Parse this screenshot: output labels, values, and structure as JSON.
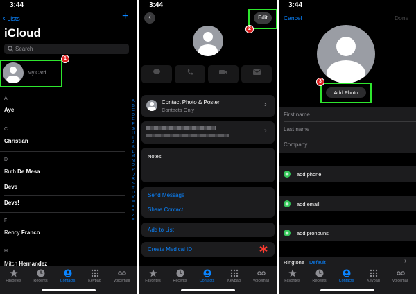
{
  "panel1": {
    "time": "3:44",
    "back_label": "Lists",
    "add_symbol": "+",
    "title": "iCloud",
    "search_placeholder": "Search",
    "my_card_label": "My Card",
    "step_badge": "1",
    "sections": [
      {
        "letter": "A",
        "names": [
          "Aye"
        ]
      },
      {
        "letter": "C",
        "names": [
          "Christian"
        ]
      },
      {
        "letter": "D",
        "names": [
          "Ruth De Mesa",
          "Devs",
          "Devs!"
        ]
      },
      {
        "letter": "F",
        "names": [
          "Rency Franco"
        ]
      },
      {
        "letter": "H",
        "names": [
          "Mitch Hernandez"
        ]
      }
    ],
    "index_letters": [
      "A",
      "B",
      "C",
      "D",
      "E",
      "F",
      "G",
      "H",
      "I",
      "J",
      "K",
      "L",
      "M",
      "N",
      "O",
      "P",
      "Q",
      "R",
      "S",
      "T",
      "U",
      "V",
      "W",
      "X",
      "Y",
      "Z",
      "#"
    ]
  },
  "panel2": {
    "time": "3:44",
    "edit_label": "Edit",
    "step_badge": "2",
    "action_buttons": [
      "message",
      "call",
      "video",
      "mail"
    ],
    "contact_photo_title": "Contact Photo & Poster",
    "contact_photo_sub": "Contacts Only",
    "notes_label": "Notes",
    "send_message": "Send Message",
    "share_contact": "Share Contact",
    "add_to_list": "Add to List",
    "create_medical_id": "Create Medical ID"
  },
  "panel3": {
    "time": "3:44",
    "cancel_label": "Cancel",
    "done_label": "Done",
    "add_photo_label": "Add Photo",
    "step_badge": "3",
    "first_name_placeholder": "First name",
    "last_name_placeholder": "Last name",
    "company_placeholder": "Company",
    "add_phone": "add phone",
    "add_email": "add email",
    "add_pronouns": "add pronouns",
    "ringtone_label": "Ringtone",
    "ringtone_value": "Default"
  },
  "tabbar": {
    "tabs": [
      "Favorites",
      "Recents",
      "Contacts",
      "Keypad",
      "Voicemail"
    ],
    "active": "Contacts"
  },
  "colors": {
    "accent": "#0a84ff",
    "highlight": "#2ee62e",
    "badge": "#e02020",
    "add_green": "#34c759"
  }
}
